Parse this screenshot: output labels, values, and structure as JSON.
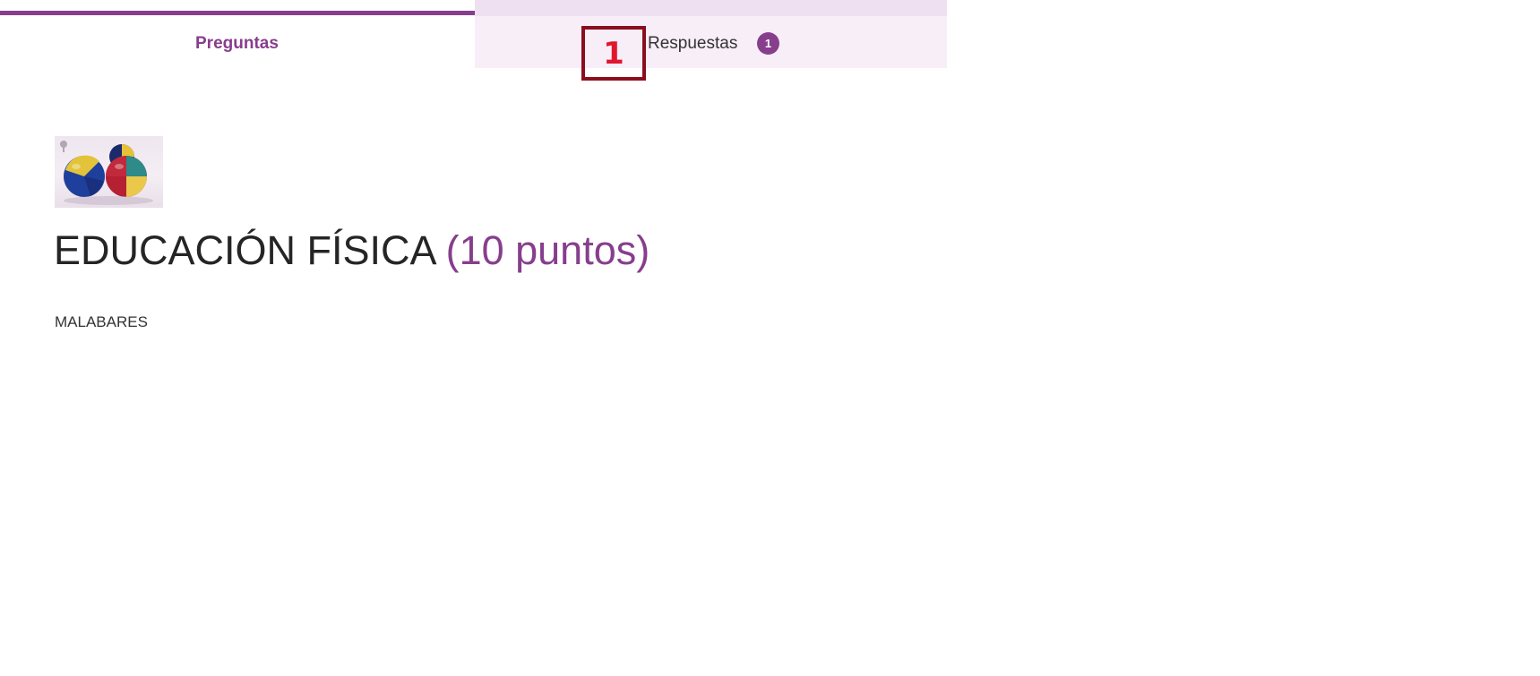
{
  "tabs": {
    "questions_label": "Preguntas",
    "responses_label": "Respuestas",
    "responses_count": "1"
  },
  "overlay": {
    "marker_label": "1"
  },
  "question": {
    "image_alt": "juggling balls",
    "title": "EDUCACIÓN FÍSICA",
    "points": "(10 puntos)",
    "description": "MALABARES"
  },
  "colors": {
    "accent": "#873e8d",
    "tab_inactive_bg": "#f7eef8",
    "marker_border": "#8b0d1e",
    "marker_text": "#e0182d"
  }
}
